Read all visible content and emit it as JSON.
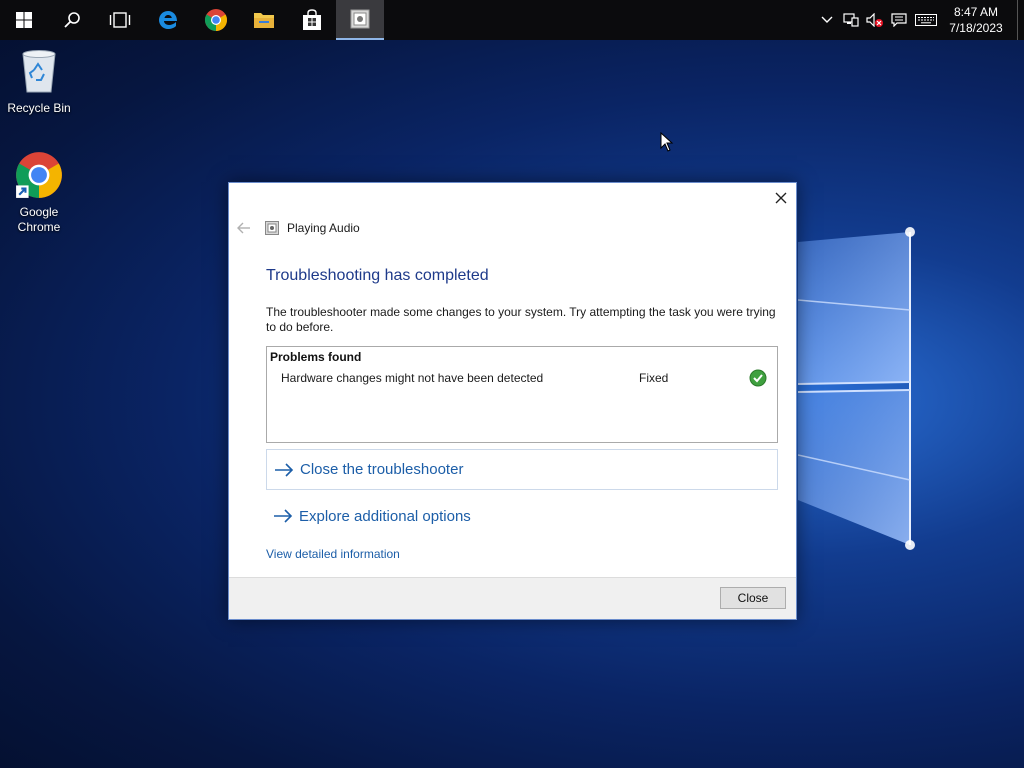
{
  "taskbar": {
    "pinned": [
      "start-icon",
      "search-icon",
      "task-view-icon",
      "edge-icon",
      "chrome-icon",
      "file-explorer-icon",
      "store-icon",
      "troubleshooter-icon"
    ],
    "clock": {
      "time": "8:47 AM",
      "date": "7/18/2023"
    },
    "tray_icons": [
      "chevron-up-icon",
      "network-icon",
      "volume-muted-icon",
      "action-center-icon",
      "keyboard-icon"
    ]
  },
  "desktop": {
    "icons": [
      {
        "label": "Recycle Bin"
      },
      {
        "label": "Google Chrome"
      }
    ]
  },
  "dialog": {
    "window_title": "Playing Audio",
    "heading": "Troubleshooting has completed",
    "description": "The troubleshooter made some changes to your system. Try attempting the task you were trying to do before.",
    "problems": {
      "title": "Problems found",
      "items": [
        {
          "text": "Hardware changes might not have been detected",
          "status": "Fixed",
          "status_icon": "green-check-icon"
        }
      ]
    },
    "links": {
      "close_troubleshooter": "Close the troubleshooter",
      "explore_options": "Explore additional options",
      "detailed_info": "View detailed information"
    },
    "footer": {
      "close_button": "Close"
    }
  },
  "colors": {
    "heading": "#1e3a8a",
    "link": "#1c5ea8",
    "taskbar": "#0b0b0d"
  }
}
